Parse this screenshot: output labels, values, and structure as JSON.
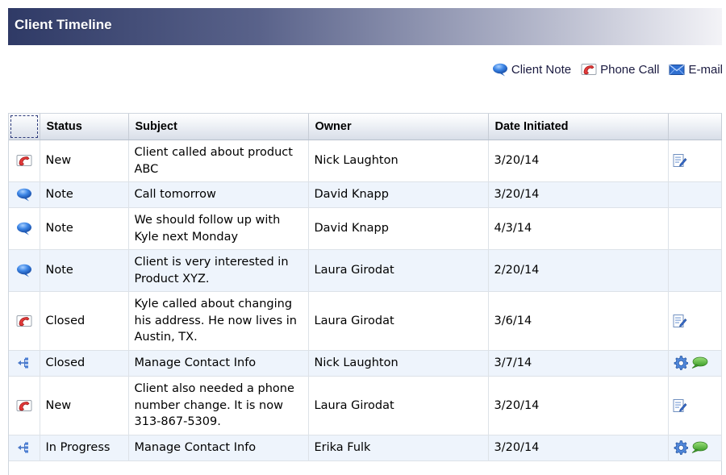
{
  "header": {
    "title": "Client Timeline"
  },
  "legend": [
    {
      "icon": "client-note-icon",
      "label": "Client Note"
    },
    {
      "icon": "phone-call-icon",
      "label": "Phone Call"
    },
    {
      "icon": "email-icon",
      "label": "E-mail"
    }
  ],
  "table": {
    "columns": [
      "",
      "Status",
      "Subject",
      "Owner",
      "Date Initiated",
      ""
    ],
    "rows": [
      {
        "type": "phone-call-icon",
        "status": "New",
        "subject": "Client called about product ABC",
        "owner": "Nick Laughton",
        "date": "3/20/14",
        "actions": [
          "edit-icon"
        ]
      },
      {
        "type": "client-note-icon",
        "status": "Note",
        "subject": "Call tomorrow",
        "owner": "David Knapp",
        "date": "3/20/14",
        "actions": []
      },
      {
        "type": "client-note-icon",
        "status": "Note",
        "subject": "We should follow up with Kyle next Monday",
        "owner": "David Knapp",
        "date": "4/3/14",
        "actions": []
      },
      {
        "type": "client-note-icon",
        "status": "Note",
        "subject": "Client is very interested in Product XYZ.",
        "owner": "Laura Girodat",
        "date": "2/20/14",
        "actions": []
      },
      {
        "type": "phone-call-icon",
        "status": "Closed",
        "subject": "Kyle called about changing his address. He now lives in Austin, TX.",
        "owner": "Laura Girodat",
        "date": "3/6/14",
        "actions": [
          "edit-icon"
        ]
      },
      {
        "type": "workflow-icon",
        "status": "Closed",
        "subject": "Manage Contact Info",
        "owner": "Nick Laughton",
        "date": "3/7/14",
        "actions": [
          "gear-icon",
          "comment-icon"
        ]
      },
      {
        "type": "phone-call-icon",
        "status": "New",
        "subject": "Client also needed a phone number change. It is now 313-867-5309.",
        "owner": "Laura Girodat",
        "date": "3/20/14",
        "actions": [
          "edit-icon"
        ]
      },
      {
        "type": "workflow-icon",
        "status": "In Progress",
        "subject": "Manage Contact Info",
        "owner": "Erika Fulk",
        "date": "3/20/14",
        "actions": [
          "gear-icon",
          "comment-icon"
        ]
      }
    ]
  }
}
